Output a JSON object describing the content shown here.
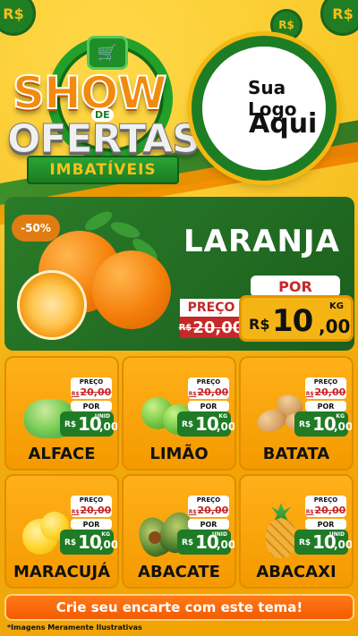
{
  "header": {
    "brand_coin_1": "R$",
    "brand_coin_2": "R$",
    "brand_coin_3": "R$",
    "title_show": "SHOW",
    "title_de": "DE",
    "title_ofertas": "OFERTAS",
    "title_imbativeis": "IMBATÍVEIS"
  },
  "logo": {
    "line1": "Sua Logo",
    "line2": "Aqui"
  },
  "featured": {
    "discount": "-50%",
    "name": "LARANJA",
    "preco_label": "PREÇO",
    "old_price_currency": "R$",
    "old_price": "20,00",
    "por_label": "POR",
    "price_currency": "R$",
    "price_int": "10",
    "price_dec": ",00",
    "unit": "KG"
  },
  "products": [
    {
      "name": "ALFACE",
      "preco_label": "PREÇO",
      "old_currency": "R$",
      "old_price": "20,00",
      "por_label": "POR",
      "price_currency": "R$",
      "price_int": "10",
      "price_dec": ",00",
      "unit": "UNID"
    },
    {
      "name": "LIMÃO",
      "preco_label": "PREÇO",
      "old_currency": "R$",
      "old_price": "20,00",
      "por_label": "POR",
      "price_currency": "R$",
      "price_int": "10",
      "price_dec": ",00",
      "unit": "KG"
    },
    {
      "name": "BATATA",
      "preco_label": "PREÇO",
      "old_currency": "R$",
      "old_price": "20,00",
      "por_label": "POR",
      "price_currency": "R$",
      "price_int": "10",
      "price_dec": ",00",
      "unit": "KG"
    },
    {
      "name": "MARACUJÁ",
      "preco_label": "PREÇO",
      "old_currency": "R$",
      "old_price": "20,00",
      "por_label": "POR",
      "price_currency": "R$",
      "price_int": "10",
      "price_dec": ",00",
      "unit": "KG"
    },
    {
      "name": "ABACATE",
      "preco_label": "PREÇO",
      "old_currency": "R$",
      "old_price": "20,00",
      "por_label": "POR",
      "price_currency": "R$",
      "price_int": "10",
      "price_dec": ",00",
      "unit": "UNID"
    },
    {
      "name": "ABACAXI",
      "preco_label": "PREÇO",
      "old_currency": "R$",
      "old_price": "20,00",
      "por_label": "POR",
      "price_currency": "R$",
      "price_int": "10",
      "price_dec": ",00",
      "unit": "UNID"
    }
  ],
  "footer": {
    "cta": "Crie seu encarte com este tema!",
    "disclaimer": "*Imagens Meramente Ilustrativas"
  },
  "colors": {
    "brand_green": "#1f7b25",
    "accent_orange": "#f49a00",
    "price_red": "#c62828",
    "background_yellow": "#f6c21a"
  }
}
